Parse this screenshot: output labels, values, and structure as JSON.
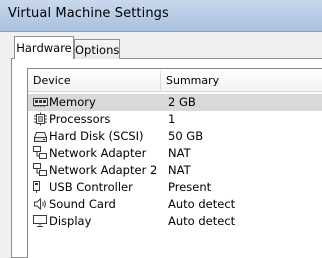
{
  "window": {
    "title": "Virtual Machine Settings"
  },
  "tabs": [
    {
      "label": "Hardware",
      "active": true
    },
    {
      "label": "Options",
      "active": false
    }
  ],
  "device_list": {
    "columns": {
      "device": "Device",
      "summary": "Summary"
    },
    "rows": [
      {
        "icon": "memory-icon",
        "device": "Memory",
        "summary": "2 GB",
        "selected": true
      },
      {
        "icon": "processor-icon",
        "device": "Processors",
        "summary": "1",
        "selected": false
      },
      {
        "icon": "hard-disk-icon",
        "device": "Hard Disk (SCSI)",
        "summary": "50 GB",
        "selected": false
      },
      {
        "icon": "network-adapter-icon",
        "device": "Network Adapter",
        "summary": "NAT",
        "selected": false
      },
      {
        "icon": "network-adapter-icon",
        "device": "Network Adapter 2",
        "summary": "NAT",
        "selected": false
      },
      {
        "icon": "usb-controller-icon",
        "device": "USB Controller",
        "summary": "Present",
        "selected": false
      },
      {
        "icon": "sound-card-icon",
        "device": "Sound Card",
        "summary": "Auto detect",
        "selected": false
      },
      {
        "icon": "display-icon",
        "device": "Display",
        "summary": "Auto detect",
        "selected": false
      }
    ]
  }
}
